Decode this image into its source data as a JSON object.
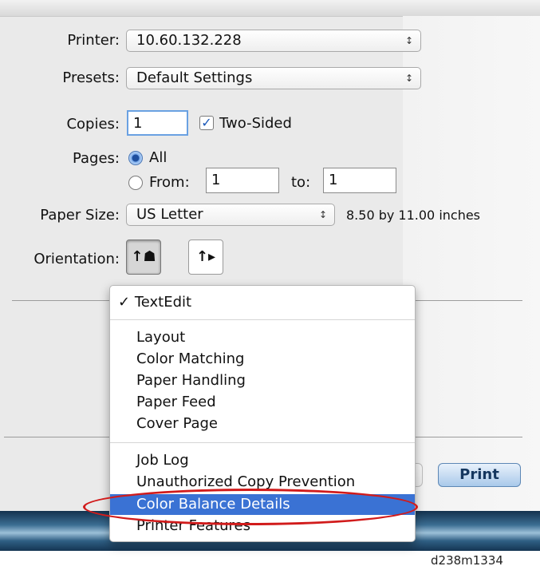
{
  "printer": {
    "label": "Printer:",
    "value": "10.60.132.228"
  },
  "presets": {
    "label": "Presets:",
    "value": "Default Settings"
  },
  "copies": {
    "label": "Copies:",
    "value": "1",
    "two_sided_label": "Two-Sided",
    "two_sided_checked": true
  },
  "pages": {
    "label": "Pages:",
    "all_label": "All",
    "from_label": "From:",
    "from_value": "1",
    "to_label": "to:",
    "to_value": "1",
    "selected": "All"
  },
  "paper_size": {
    "label": "Paper Size:",
    "value": "US Letter",
    "dimensions": "8.50 by 11.00 inches"
  },
  "orientation": {
    "label": "Orientation:",
    "portrait_icon": "↑portrait-icon",
    "landscape_icon": "↑landscape-icon",
    "selected": "portrait"
  },
  "menu": {
    "checked_item": "TextEdit",
    "group1": [
      "Layout",
      "Color Matching",
      "Paper Handling",
      "Paper Feed",
      "Cover Page"
    ],
    "group2": [
      "Job Log",
      "Unauthorized Copy Prevention",
      "Color Balance Details",
      "Printer Features"
    ],
    "selected_item": "Color Balance Details"
  },
  "buttons": {
    "print_label": "Print"
  },
  "caption": "d238m1334",
  "colors": {
    "selection": "#3a72d4",
    "highlight_oval": "#d11b1b"
  }
}
